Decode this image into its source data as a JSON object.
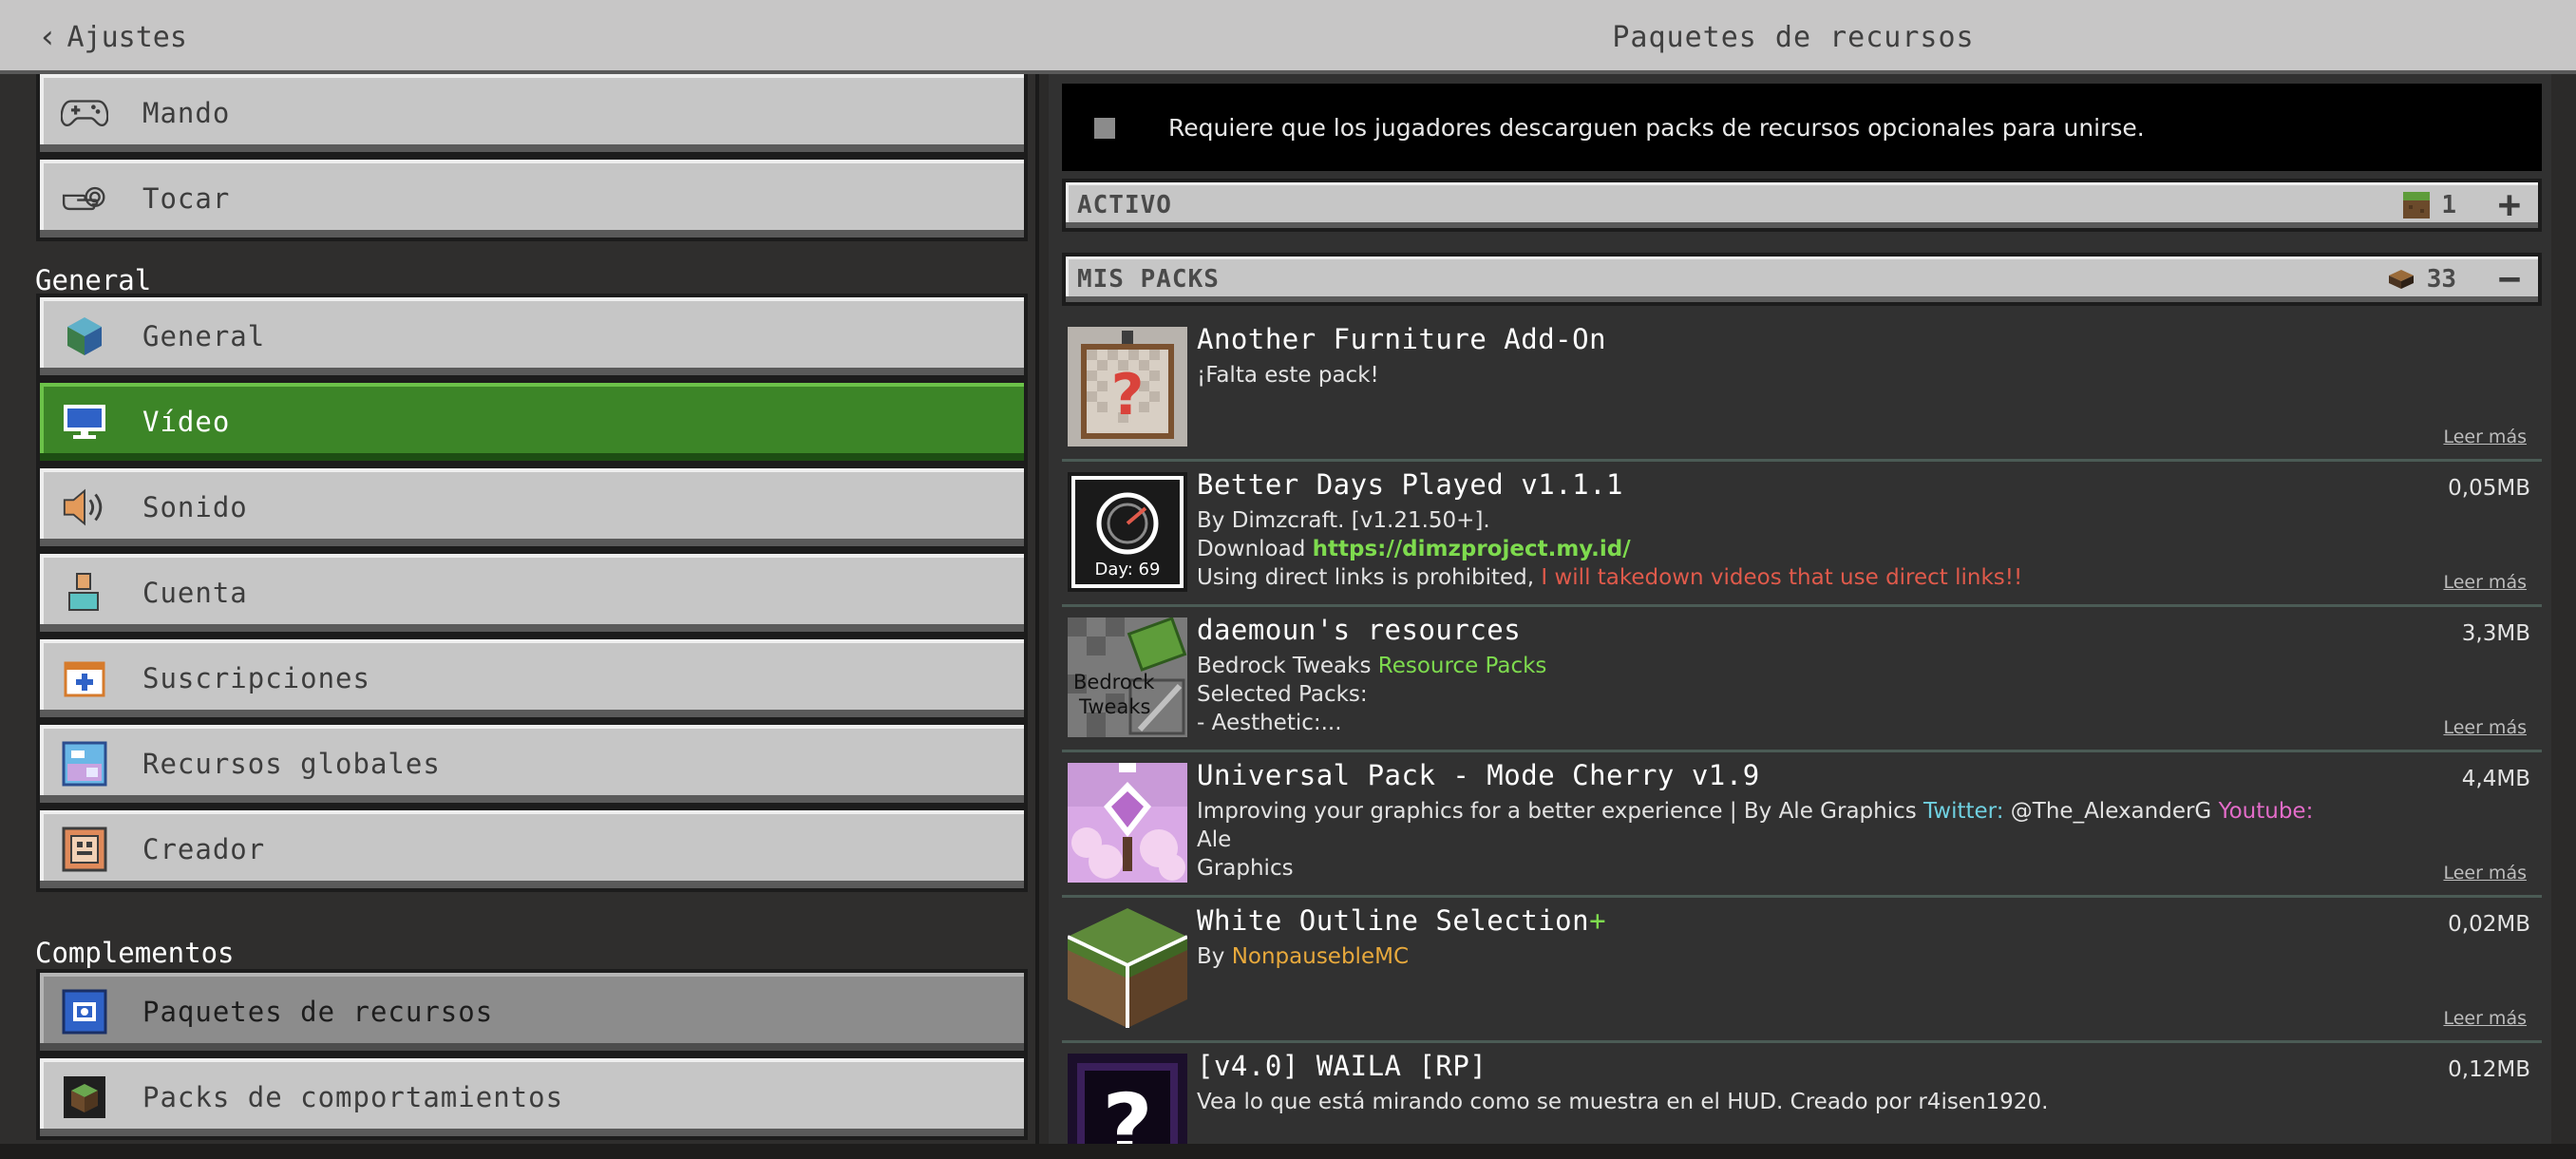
{
  "topbar": {
    "back_label": "Ajustes",
    "title": "Paquetes de recursos"
  },
  "sidebar": {
    "items_top": [
      {
        "label": "Mando",
        "icon": "gamepad-icon"
      },
      {
        "label": "Tocar",
        "icon": "touch-icon"
      }
    ],
    "section_general": "General",
    "items_general": [
      {
        "label": "General",
        "icon": "cube-icon"
      },
      {
        "label": "Vídeo",
        "icon": "monitor-icon"
      },
      {
        "label": "Sonido",
        "icon": "speaker-icon"
      },
      {
        "label": "Cuenta",
        "icon": "account-icon"
      },
      {
        "label": "Suscripciones",
        "icon": "calendar-plus-icon"
      },
      {
        "label": "Recursos globales",
        "icon": "globe-image-icon"
      },
      {
        "label": "Creador",
        "icon": "creator-icon"
      }
    ],
    "section_addons": "Complementos",
    "items_addons": [
      {
        "label": "Paquetes de recursos",
        "icon": "resource-pack-icon"
      },
      {
        "label": "Packs de comportamientos",
        "icon": "behavior-pack-icon"
      }
    ]
  },
  "notice": {
    "text": "Requiere que los jugadores descarguen packs de recursos opcionales para unirse."
  },
  "active_header": {
    "label": "ACTIVO",
    "count": "1",
    "action": "+"
  },
  "mypacks_header": {
    "label": "MIS PACKS",
    "count": "33",
    "action": "−"
  },
  "packs": [
    {
      "name": "Another Furniture Add-On",
      "line1": "¡Falta este pack!",
      "size": "",
      "more": "Leer más"
    },
    {
      "name": "Better Days Played v1.1.1",
      "line1": "By Dimzcraft. [v1.21.50+].",
      "line2_prefix": "Download ",
      "line2_link": "https://dimzproject.my.id/",
      "line3_prefix": "Using direct links is prohibited, ",
      "line3_warning": "I will takedown videos that use direct links!!",
      "thumb_text": "Day: 69",
      "size": "0,05MB",
      "more": "Leer más"
    },
    {
      "name": "daemoun's resources",
      "line1_prefix": "Bedrock Tweaks ",
      "line1_green": "Resource Packs",
      "line2": "Selected Packs:",
      "line3": "- Aesthetic:...",
      "thumb_text1": "Bedrock",
      "thumb_text2": "Tweaks",
      "size": "3,3MB",
      "more": "Leer más"
    },
    {
      "name": "Universal Pack - Mode Cherry v1.9",
      "line1_prefix": "Improving your graphics for a better experience | By Ale Graphics ",
      "twitter_label": "Twitter:",
      "twitter_handle": " @The_AlexanderG ",
      "youtube_label": "Youtube:",
      "youtube_tail": " Ale",
      "line2": "Graphics",
      "size": "4,4MB",
      "more": "Leer más"
    },
    {
      "name": "White Outline Selection",
      "name_plus": "+",
      "line1_prefix": "By ",
      "line1_author": "NonpausebleMC",
      "size": "0,02MB",
      "more": "Leer más"
    },
    {
      "name": "[v4.0] WAILA [RP]",
      "line1": "Vea lo que está mirando como se muestra en el HUD. Creado por r4isen1920.",
      "size": "0,12MB"
    }
  ],
  "colors": {
    "active_green": "#3c8527",
    "button_gray": "#c6c6c6",
    "link_green": "#7edb4e",
    "warning_red": "#e05a4b"
  }
}
